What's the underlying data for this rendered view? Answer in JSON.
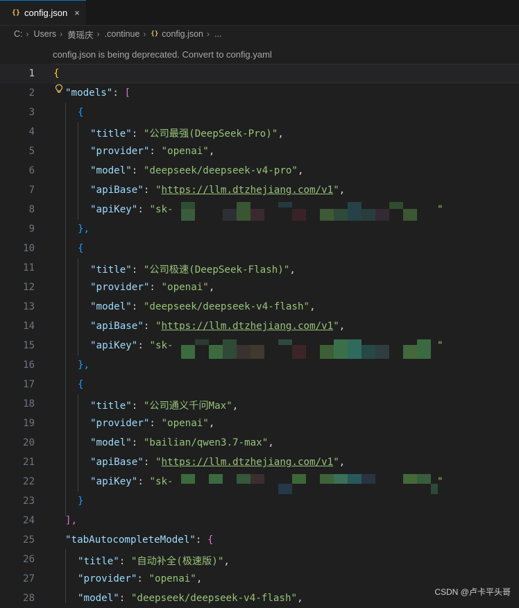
{
  "tab": {
    "label": "config.json",
    "icon": "{}",
    "close": "×"
  },
  "breadcrumb": {
    "items": [
      "C:",
      "Users",
      "黄瑶庆",
      ".continue"
    ],
    "file": "config.json",
    "more": "...",
    "icon": "{}"
  },
  "hint": "config.json is being deprecated. Convert to config.yaml",
  "line_numbers": [
    "1",
    "2",
    "3",
    "4",
    "5",
    "6",
    "7",
    "8",
    "9",
    "10",
    "11",
    "12",
    "13",
    "14",
    "15",
    "16",
    "17",
    "18",
    "19",
    "20",
    "21",
    "22",
    "23",
    "24",
    "25",
    "26",
    "27",
    "28"
  ],
  "code": {
    "l1": "{",
    "l2_key": "\"models\"",
    "l2_colon": ": ",
    "l2_bracket": "[",
    "l3": "{",
    "title_key": "\"title\"",
    "provider_key": "\"provider\"",
    "model_key": "\"model\"",
    "apibase_key": "\"apiBase\"",
    "apikey_key": "\"apiKey\"",
    "colon": ": ",
    "comma": ",",
    "quote": "\"",
    "m1_title": "\"公司最强(DeepSeek-Pro)\"",
    "m1_provider": "\"openai\"",
    "m1_model": "\"deepseek/deepseek-v4-pro\"",
    "m1_apibase_url": "https://llm.dtzhejiang.com/v1",
    "m1_apikey_prefix": "\"sk-",
    "close_obj": "}",
    "close_obj_comma": "},",
    "m2_title": "\"公司极速(DeepSeek-Flash)\"",
    "m2_provider": "\"openai\"",
    "m2_model": "\"deepseek/deepseek-v4-flash\"",
    "m2_apibase_url": "https://llm.dtzhejiang.com/v1",
    "m2_apikey_prefix": "\"sk-",
    "m3_title": "\"公司通义千问Max\"",
    "m3_provider": "\"openai\"",
    "m3_model": "\"bailian/qwen3.7-max\"",
    "m3_apibase_url": "https://llm.dtzhejiang.com/v1",
    "m3_apikey_prefix": "\"sk-",
    "l24": "],",
    "l25_key": "\"tabAutocompleteModel\"",
    "l25_brace": "{",
    "l26_title": "\"自动补全(极速版)\"",
    "l27_provider": "\"openai\"",
    "l28_model": "\"deepseek/deepseek-v4-flash\""
  },
  "watermark": "CSDN @卢卡平头哥",
  "colors": {
    "key": "#9cdcfe",
    "string": "#98c379",
    "bracket_gold": "#ffd700",
    "bracket_purple": "#da70d6",
    "bracket_blue": "#179fff",
    "tab_border": "#0078d4"
  },
  "icons": {
    "bulb": "lightbulb-icon",
    "json": "json-file-icon",
    "close": "close-icon"
  }
}
